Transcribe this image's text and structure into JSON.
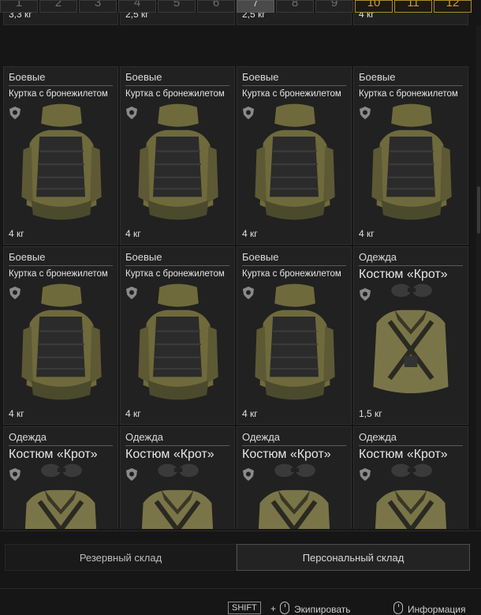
{
  "tabs": [
    "1",
    "2",
    "3",
    "4",
    "5",
    "6",
    "7",
    "8",
    "9",
    "10",
    "11",
    "12"
  ],
  "active_tab": "7",
  "gold_tabs": [
    "10",
    "11",
    "12"
  ],
  "cards": [
    {
      "category": "",
      "name": "",
      "weight": "3,3 кг",
      "art": "partial"
    },
    {
      "category": "",
      "name": "",
      "weight": "2,5 кг",
      "art": "partial"
    },
    {
      "category": "",
      "name": "",
      "weight": "2,5 кг",
      "art": "partial"
    },
    {
      "category": "",
      "name": "",
      "weight": "4 кг",
      "art": "partial"
    },
    {
      "category": "Боевые",
      "name": "Куртка с бронежилетом",
      "weight": "4 кг",
      "art": "vest"
    },
    {
      "category": "Боевые",
      "name": "Куртка с бронежилетом",
      "weight": "4 кг",
      "art": "vest"
    },
    {
      "category": "Боевые",
      "name": "Куртка с бронежилетом",
      "weight": "4 кг",
      "art": "vest"
    },
    {
      "category": "Боевые",
      "name": "Куртка с бронежилетом",
      "weight": "4 кг",
      "art": "vest"
    },
    {
      "category": "Боевые",
      "name": "Куртка с бронежилетом",
      "weight": "4 кг",
      "art": "vest"
    },
    {
      "category": "Боевые",
      "name": "Куртка с бронежилетом",
      "weight": "4 кг",
      "art": "vest"
    },
    {
      "category": "Боевые",
      "name": "Куртка с бронежилетом",
      "weight": "4 кг",
      "art": "vest"
    },
    {
      "category": "Одежда",
      "name": "Костюм «Крот»",
      "weight": "1,5 кг",
      "art": "mole"
    },
    {
      "category": "Одежда",
      "name": "Костюм «Крот»",
      "weight": "",
      "art": "mole"
    },
    {
      "category": "Одежда",
      "name": "Костюм «Крот»",
      "weight": "",
      "art": "mole"
    },
    {
      "category": "Одежда",
      "name": "Костюм «Крот»",
      "weight": "",
      "art": "mole"
    },
    {
      "category": "Одежда",
      "name": "Костюм «Крот»",
      "weight": "",
      "art": "mole"
    }
  ],
  "storage": {
    "reserve": "Резервный склад",
    "personal": "Персональный склад"
  },
  "hints": {
    "shift": "SHIFT",
    "plus": "+",
    "equip": "Экипировать",
    "info": "Информация"
  },
  "colors": {
    "gold": "#c89b35",
    "vest_olive": "#6f6a3c",
    "vest_dark": "#2b2b2b",
    "mole_khaki": "#7a7548"
  }
}
